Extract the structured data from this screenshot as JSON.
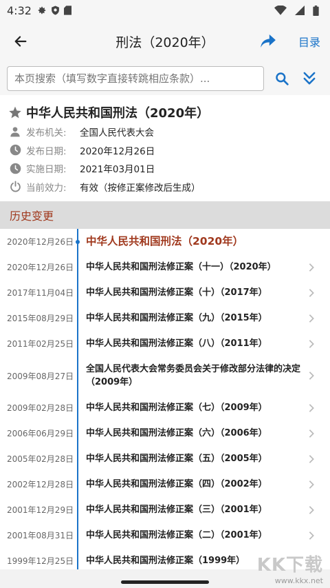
{
  "status_bar": {
    "time": "4:32"
  },
  "app_bar": {
    "title": "刑法（2020年）",
    "toc_label": "目录"
  },
  "search": {
    "placeholder": "本页搜索（填写数字直接转跳相应条款）..."
  },
  "law": {
    "title": "中华人民共和国刑法（2020年）",
    "meta": [
      {
        "icon": "person-icon",
        "label": "发布机关:",
        "value": "全国人民代表大会"
      },
      {
        "icon": "clock-icon",
        "label": "发布日期:",
        "value": "2020年12月26日"
      },
      {
        "icon": "clock-icon",
        "label": "实施日期:",
        "value": "2021年03月01日"
      },
      {
        "icon": "power-icon",
        "label": "当前效力:",
        "value": "有效（按修正案修改后生成）"
      }
    ]
  },
  "history": {
    "header": "历史变更",
    "items": [
      {
        "date": "2020年12月26日",
        "name": "中华人民共和国刑法（2020年）"
      },
      {
        "date": "2020年12月26日",
        "name": "中华人民共和国刑法修正案（十一）（2020年）"
      },
      {
        "date": "2017年11月04日",
        "name": "中华人民共和国刑法修正案（十）（2017年）"
      },
      {
        "date": "2015年08月29日",
        "name": "中华人民共和国刑法修正案（九）（2015年）"
      },
      {
        "date": "2011年02月25日",
        "name": "中华人民共和国刑法修正案（八）（2011年）"
      },
      {
        "date": "2009年08月27日",
        "name": "全国人民代表大会常务委员会关于修改部分法律的决定（2009年）"
      },
      {
        "date": "2009年02月28日",
        "name": "中华人民共和国刑法修正案（七）（2009年）"
      },
      {
        "date": "2006年06月29日",
        "name": "中华人民共和国刑法修正案（六）（2006年）"
      },
      {
        "date": "2005年02月28日",
        "name": "中华人民共和国刑法修正案（五）（2005年）"
      },
      {
        "date": "2002年12月28日",
        "name": "中华人民共和国刑法修正案（四）（2002年）"
      },
      {
        "date": "2001年12月29日",
        "name": "中华人民共和国刑法修正案（三）（2001年）"
      },
      {
        "date": "2001年08月31日",
        "name": "中华人民共和国刑法修正案（二）（2001年）"
      },
      {
        "date": "1999年12月25日",
        "name": "中华人民共和国刑法修正案（1999年）"
      }
    ]
  },
  "watermark": {
    "logo": "KK下载",
    "url": "www.kkx.net"
  },
  "colors": {
    "accent": "#1a73c8",
    "history_red": "#a0391e"
  }
}
